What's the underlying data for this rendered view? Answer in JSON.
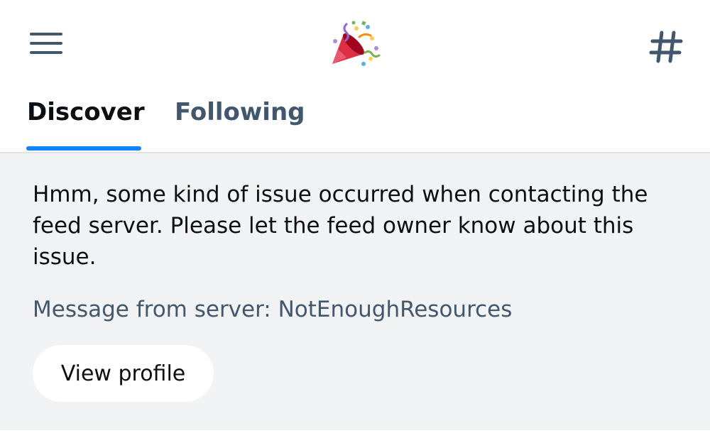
{
  "header": {
    "menu_icon": "hamburger-menu-icon",
    "logo_icon": "party-popper-icon",
    "feeds_icon": "hashtag-icon"
  },
  "tabs": [
    {
      "label": "Discover",
      "selected": true
    },
    {
      "label": "Following",
      "selected": false
    }
  ],
  "feed_error": {
    "message": "Hmm, some kind of issue occurred when contacting the feed server. Please let the feed owner know about this issue.",
    "server_message": "Message from server: NotEnoughResources",
    "view_profile_label": "View profile"
  },
  "colors": {
    "accent": "#1083fe",
    "primary_text": "#0b0f14",
    "secondary_text": "#42576c",
    "panel_background": "#f1f3f5"
  }
}
